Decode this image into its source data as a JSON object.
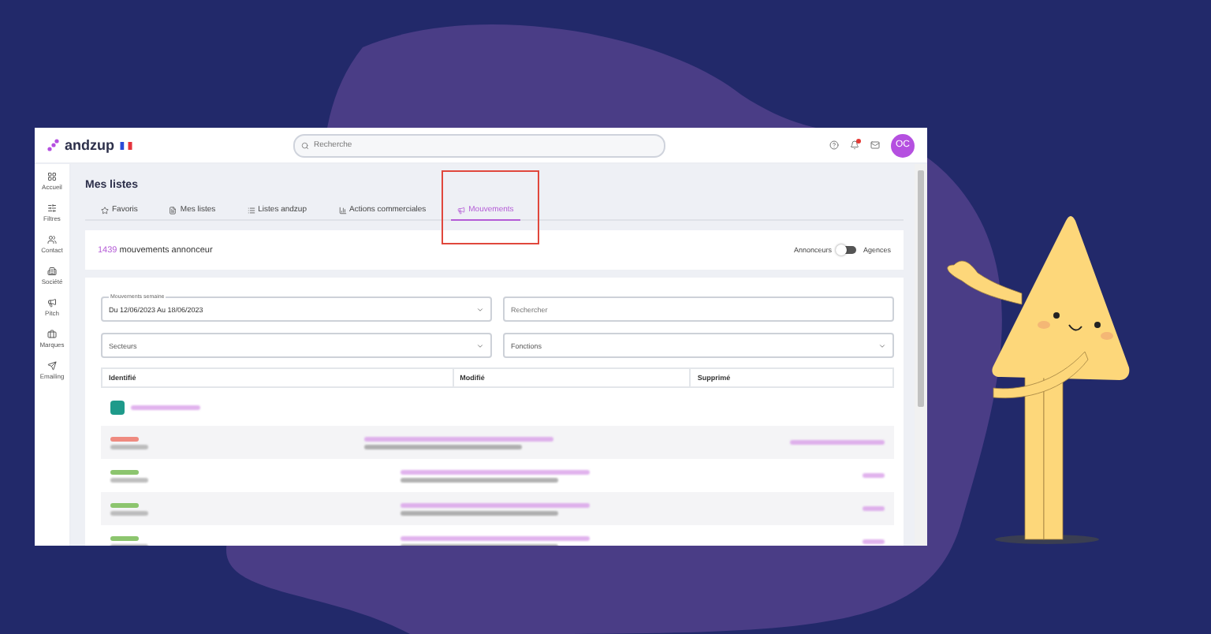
{
  "brand": {
    "name": "andzup"
  },
  "search": {
    "placeholder": "Recherche"
  },
  "notifications": {
    "unread": true
  },
  "avatar": {
    "initials": "OC"
  },
  "sidebar": {
    "items": [
      {
        "label": "Accueil"
      },
      {
        "label": "Filtres"
      },
      {
        "label": "Contact"
      },
      {
        "label": "Société"
      },
      {
        "label": "Pitch"
      },
      {
        "label": "Marques"
      },
      {
        "label": "Emailing"
      }
    ]
  },
  "page_title": "Mes listes",
  "tabs": [
    {
      "label": "Favoris",
      "selected": false,
      "highlighted": false
    },
    {
      "label": "Mes listes",
      "selected": false,
      "highlighted": false
    },
    {
      "label": "Listes andzup",
      "selected": false,
      "highlighted": false
    },
    {
      "label": "Actions commerciales",
      "selected": false,
      "highlighted": false
    },
    {
      "label": "Mouvements",
      "selected": true,
      "highlighted": true
    }
  ],
  "summary": {
    "count": "1439",
    "text": "mouvements annonceur"
  },
  "toggle": {
    "left_label": "Annonceurs",
    "right_label": "Agences",
    "on": false
  },
  "filters": [
    {
      "kind": "select",
      "label": "Mouvements semaine",
      "value": "Du 12/06/2023 Au 18/06/2023"
    },
    {
      "kind": "input",
      "placeholder": "Rechercher"
    },
    {
      "kind": "select",
      "placeholder": "Secteurs"
    },
    {
      "kind": "select",
      "placeholder": "Fonctions"
    }
  ],
  "columns": [
    "Identifié",
    "Modifié",
    "Supprimé"
  ],
  "rows": [
    {
      "color": "#ef8a80"
    },
    {
      "color": "#8cc56e"
    },
    {
      "color": "#8cc56e"
    },
    {
      "color": "#8cc56e"
    }
  ]
}
